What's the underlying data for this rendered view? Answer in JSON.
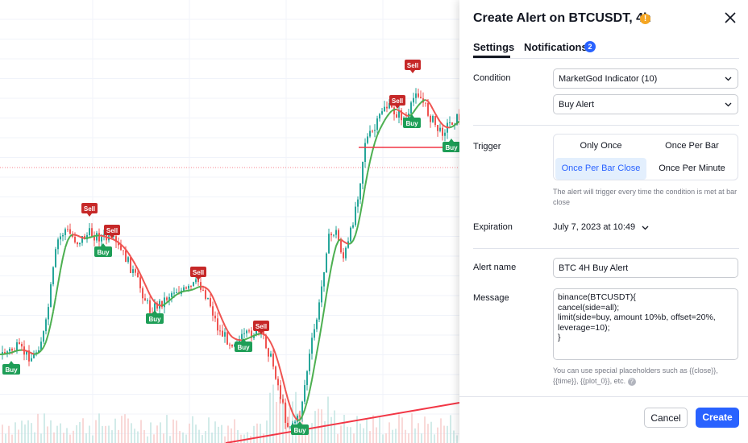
{
  "chart": {
    "signals": [
      {
        "type": "sell",
        "label": "Sell",
        "ref": 1
      },
      {
        "type": "sell",
        "label": "Sell",
        "ref": 2
      },
      {
        "type": "sell",
        "label": "Sell",
        "ref": 3
      },
      {
        "type": "sell",
        "label": "Sell",
        "ref": 4
      },
      {
        "type": "sell",
        "label": "Sell",
        "ref": 5
      },
      {
        "type": "sell",
        "label": "Sell",
        "ref": 6
      },
      {
        "type": "buy",
        "label": "Buy",
        "ref": 7
      },
      {
        "type": "buy",
        "label": "Buy",
        "ref": 8
      },
      {
        "type": "buy",
        "label": "Buy",
        "ref": 9
      },
      {
        "type": "buy",
        "label": "Buy",
        "ref": 10
      },
      {
        "type": "buy",
        "label": "Buy",
        "ref": 11
      },
      {
        "type": "buy",
        "label": "Buy",
        "ref": 12
      },
      {
        "type": "buy",
        "label": "Buy",
        "ref": 13
      }
    ],
    "colors": {
      "buy": "#1e9e57",
      "sell": "#c62828",
      "up_candle": "#26a69a",
      "down_candle": "#ef5350",
      "ma_up": "#4caf50",
      "ma_down": "#ef5350",
      "trendline": "#f23645"
    }
  },
  "dialog": {
    "title": "Create Alert on BTCUSDT, 4h",
    "warning_icon": "!",
    "tabs": {
      "settings": "Settings",
      "notifications": "Notifications",
      "notifications_count": "2"
    },
    "condition": {
      "label": "Condition",
      "indicator": "MarketGod Indicator (10)",
      "alert": "Buy Alert"
    },
    "trigger": {
      "label": "Trigger",
      "options": [
        "Only Once",
        "Once Per Bar",
        "Once Per Bar Close",
        "Once Per Minute"
      ],
      "selected": "Once Per Bar Close",
      "hint": "The alert will trigger every time the condition is met at bar close"
    },
    "expiration": {
      "label": "Expiration",
      "value": "July 7, 2023 at 10:49"
    },
    "alert_name": {
      "label": "Alert name",
      "value": "BTC 4H Buy Alert"
    },
    "message": {
      "label": "Message",
      "value": "binance(BTCUSDT){\ncancel(side=all);\nlimit(side=buy, amount 10%b, offset=20%,\nleverage=10);\n}",
      "hint": "You can use special placeholders such as {{close}}, {{time}}, {{plot_0}}, etc."
    },
    "buttons": {
      "cancel": "Cancel",
      "create": "Create"
    }
  }
}
